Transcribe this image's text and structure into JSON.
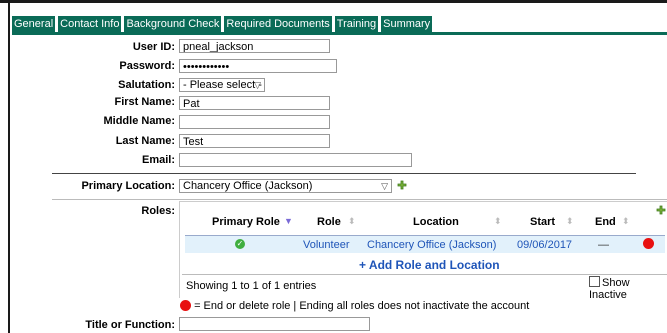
{
  "tabs": [
    "General",
    "Contact Info",
    "Background Check",
    "Required Documents",
    "Training",
    "Summary"
  ],
  "form": {
    "user_id_label": "User ID:",
    "user_id_value": "pneal_jackson",
    "password_label": "Password:",
    "password_value": "••••••••••••",
    "salutation_label": "Salutation:",
    "salutation_value": "- Please select -",
    "first_name_label": "First Name:",
    "first_name_value": "Pat",
    "middle_name_label": "Middle Name:",
    "middle_name_value": "",
    "last_name_label": "Last Name:",
    "last_name_value": "Test",
    "email_label": "Email:",
    "email_value": "",
    "primary_location_label": "Primary Location:",
    "primary_location_value": "Chancery Office (Jackson)",
    "roles_label": "Roles:",
    "title_label": "Title or Function:",
    "title_value": ""
  },
  "roles_table": {
    "headers": [
      "Primary Role",
      "Role",
      "Location",
      "Start",
      "End"
    ],
    "rows": [
      {
        "primary": true,
        "role": "Volunteer",
        "location": "Chancery Office (Jackson)",
        "start": "09/06/2017",
        "end": "—"
      }
    ],
    "add_label": "+ Add Role and Location",
    "showing": "Showing 1 to 1 of 1 entries",
    "show_inactive_label": "Show Inactive",
    "show_inactive_checked": false
  },
  "legend_text": "= End or delete role | Ending all roles does not inactivate the account",
  "colors": {
    "tab_bg": "#0a6b57",
    "link": "#1f55b8",
    "row_bg": "#e2f1fb",
    "delete": "#e81010",
    "check": "#3fae3f"
  }
}
